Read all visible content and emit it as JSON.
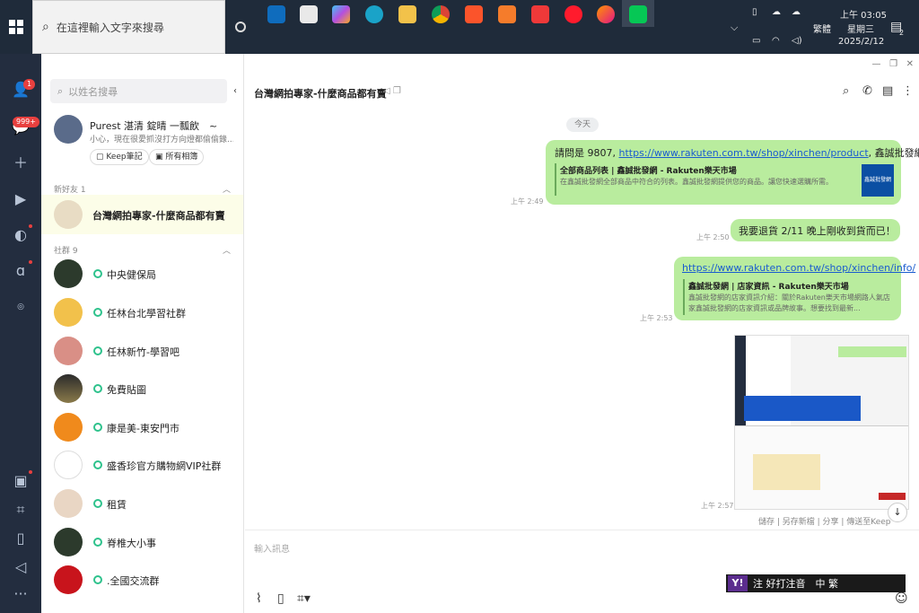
{
  "taskbar": {
    "search_placeholder": "在這裡輸入文字來搜尋",
    "clock_time": "上午 03:05",
    "clock_day": "星期三",
    "clock_date": "2025/2/12",
    "ime_lang": "繁體",
    "notif_count": "2"
  },
  "nav": {
    "friends_badge": "1",
    "chats_badge": "999+"
  },
  "list": {
    "search_placeholder": "以姓名搜尋",
    "profile_name": "Purest 湛清 錠晴 一瓢飲　~",
    "profile_status": "小心，現在很愛抓沒打方向燈都偷偷錄...",
    "keep_btn": "Keep筆記",
    "album_btn": "所有相簿",
    "new_friends_label": "新好友 1",
    "selected_chat": "台灣網拍專家-什麼商品都有賣",
    "communities_label": "社群 9",
    "communities": [
      "中央健保局",
      "任林台北學習社群",
      "任林新竹-學習吧",
      "免費貼圖",
      "康是美-東安門市",
      "盛香珍官方購物網VIP社群",
      "租賃",
      "脊椎大小事",
      ".全國交流群"
    ]
  },
  "chat": {
    "title": "台灣網拍專家-什麼商品都有賣",
    "date_divider": "今天",
    "msg1_text_a": "請問是 9807, ",
    "msg1_link": "https://www.rakuten.com.tw/shop/xinchen/product",
    "msg1_text_b": ", 鑫誠批發網",
    "msg1_prev_title": "全部商品列表 | 鑫誠批發網 - Rakuten樂天市場",
    "msg1_prev_desc": "在鑫誠批發網全部商品中符合的列表。鑫誠批發網提供您的商品。讓您快速選購所需。",
    "msg1_thumb": "鑫誠批發網",
    "msg1_time": "上午 2:49",
    "msg2_text": "我要退貨 2/11 晚上剛收到貨而已！",
    "msg2_time": "上午 2:50",
    "msg3_link": "https://www.rakuten.com.tw/shop/xinchen/info/",
    "msg3_prev_title": "鑫誠批發網 | 店家資訊 - Rakuten樂天市場",
    "msg3_prev_desc": "鑫誠批發網的店家資訊介紹：關於Rakuten樂天市場網路人氣店家鑫誠批發網的店家資訊或品牌故事。想要找到最新...",
    "msg3_time": "上午 2:53",
    "img_time": "上午 2:57",
    "img_actions": "儲存 | 另存新檔 | 分享 | 傳送至Keep",
    "input_placeholder": "輸入訊息",
    "ime_text": "注 好打注音　中 繁"
  }
}
